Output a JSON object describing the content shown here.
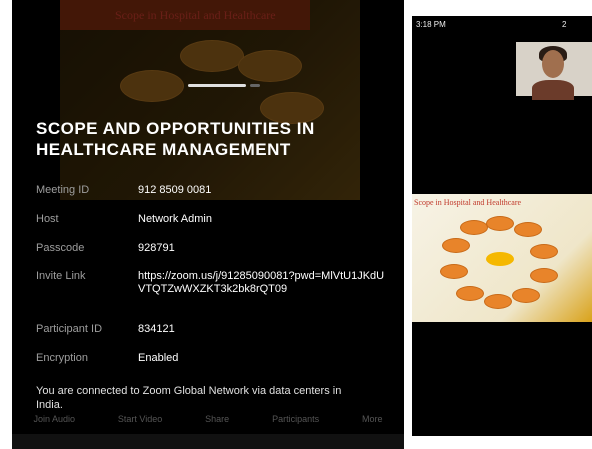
{
  "meeting": {
    "title": "SCOPE AND OPPORTUNITIES IN HEALTHCARE MANAGEMENT",
    "rows": [
      {
        "label": "Meeting ID",
        "value": "912 8509 0081"
      },
      {
        "label": "Host",
        "value": "Network Admin"
      },
      {
        "label": "Passcode",
        "value": "928791"
      },
      {
        "label": "Invite Link",
        "value": "https://zoom.us/j/91285090081?pwd=MlVtU1JKdUVTQTZwWXZKT3k2bk8rQT09"
      },
      {
        "label": "Participant ID",
        "value": "834121"
      },
      {
        "label": "Encryption",
        "value": "Enabled"
      }
    ],
    "network_note": "You are connected to Zoom Global Network via data centers in India."
  },
  "slide": {
    "title": "Scope in Hospital and Healthcare"
  },
  "toolbar": {
    "items": [
      "Join Audio",
      "Start Video",
      "Share",
      "Participants",
      "More"
    ]
  },
  "right_phone": {
    "status_time": "3:18 PM",
    "status_right": "2"
  },
  "colors": {
    "panel_bg": "#000000",
    "label_gray": "#9e9e9e",
    "slide_accent": "#c0392b"
  }
}
